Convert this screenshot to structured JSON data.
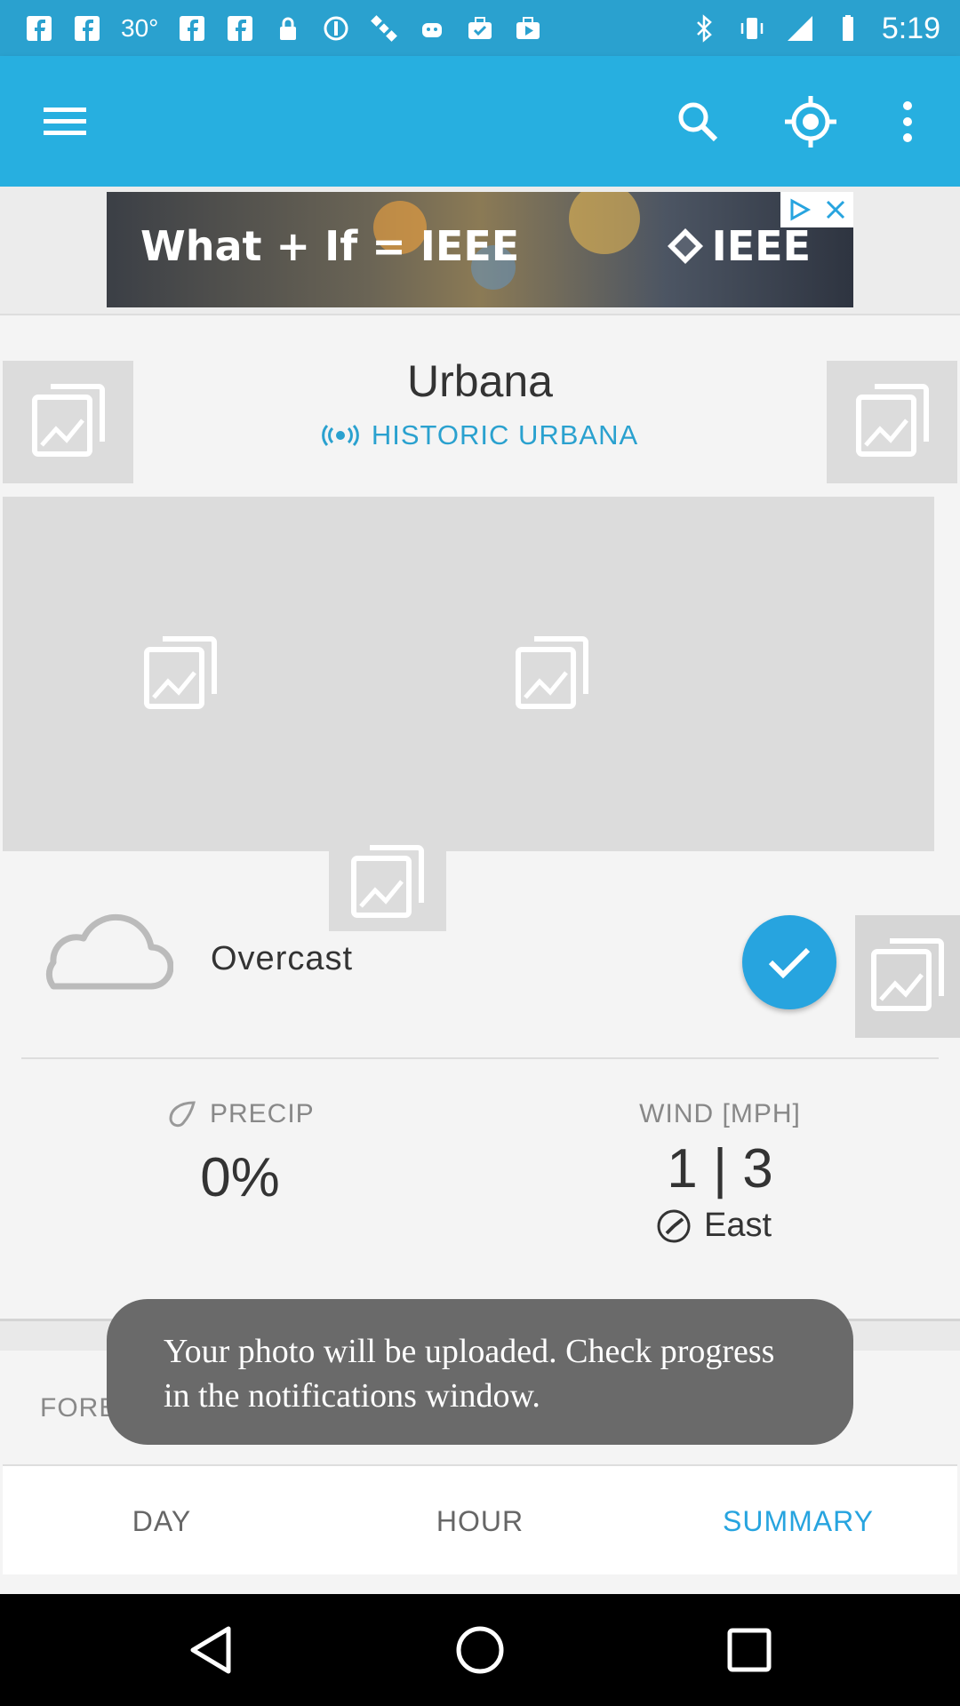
{
  "status_bar": {
    "temperature": "30°",
    "time": "5:19"
  },
  "toolbar": {
    "menu_icon": "menu-icon",
    "search_icon": "search-icon",
    "location_icon": "gps-icon",
    "overflow_icon": "more-vert-icon"
  },
  "ad": {
    "text": "What + If = IEEE",
    "brand": "IEEE"
  },
  "location": {
    "city": "Urbana",
    "station": "HISTORIC URBANA"
  },
  "conditions": {
    "summary": "Overcast",
    "precip_label": "PRECIP",
    "precip_value": "0%",
    "wind_label": "WIND [MPH]",
    "wind_value": "1 | 3",
    "wind_direction": "East"
  },
  "forecast": {
    "label": "FORECAST"
  },
  "toast": {
    "message": "Your photo will be uploaded. Check progress in the notifications window."
  },
  "tabs": [
    {
      "label": "DAY",
      "active": false
    },
    {
      "label": "HOUR",
      "active": false
    },
    {
      "label": "SUMMARY",
      "active": true
    }
  ],
  "colors": {
    "toolbar": "#27afe0",
    "status_bar": "#2aa1cf",
    "accent": "#27a4df",
    "toast": "#6a6a6a"
  }
}
